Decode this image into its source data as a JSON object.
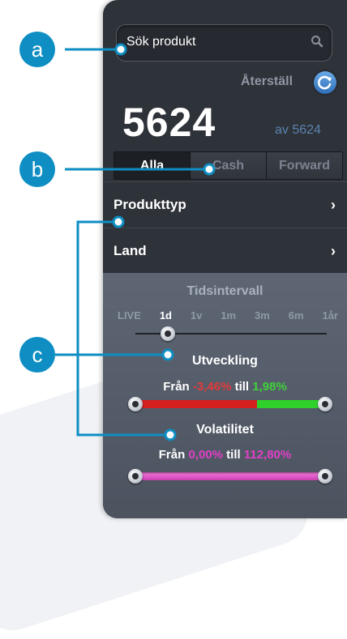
{
  "search": {
    "placeholder": "Sök produkt",
    "icon": "search-icon"
  },
  "reset": {
    "label": "Återställ",
    "icon": "refresh-icon"
  },
  "results": {
    "count": "5624",
    "of_label": "av 5624"
  },
  "segments": [
    {
      "label": "Alla",
      "active": true
    },
    {
      "label": "Cash",
      "active": false
    },
    {
      "label": "Forward",
      "active": false
    }
  ],
  "filters": [
    {
      "label": "Produkttyp",
      "chevron": "›"
    },
    {
      "label": "Land",
      "chevron": "›"
    }
  ],
  "time_interval": {
    "title": "Tidsintervall",
    "ticks": [
      "LIVE",
      "1d",
      "1v",
      "1m",
      "3m",
      "6m",
      "1år"
    ],
    "selected": "1d"
  },
  "development": {
    "title": "Utveckling",
    "from_label": "Från",
    "from_value": "-3,46%",
    "to_label": "till",
    "to_value": "1,98%"
  },
  "volatility": {
    "title": "Volatilitet",
    "from_label": "Från",
    "from_value": "0,00%",
    "to_label": "till",
    "to_value": "112,80%"
  },
  "callouts": [
    "a",
    "b",
    "c"
  ],
  "colors": {
    "accent": "#0e8ec3",
    "negative": "#e23a3a",
    "positive": "#3ed13a",
    "volatility": "#e040c8",
    "reset_blue": "#3b82c8"
  }
}
